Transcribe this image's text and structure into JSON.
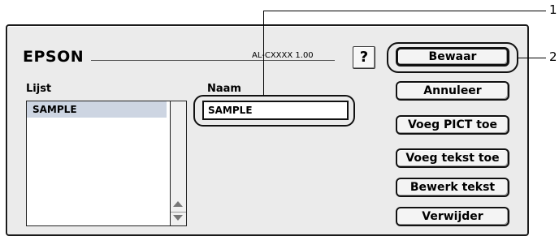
{
  "dialog": {
    "brand": "EPSON",
    "model": "AL-CXXXX  1.00",
    "help_label": "?"
  },
  "list": {
    "label": "Lijst",
    "items": [
      "SAMPLE"
    ]
  },
  "name_field": {
    "label": "Naam",
    "value": "SAMPLE"
  },
  "buttons": {
    "save": "Bewaar",
    "cancel": "Annuleer",
    "add_pict": "Voeg PICT toe",
    "add_text": "Voeg tekst toe",
    "edit_text": "Bewerk tekst",
    "delete": "Verwijder"
  },
  "callouts": [
    "1",
    "2"
  ]
}
